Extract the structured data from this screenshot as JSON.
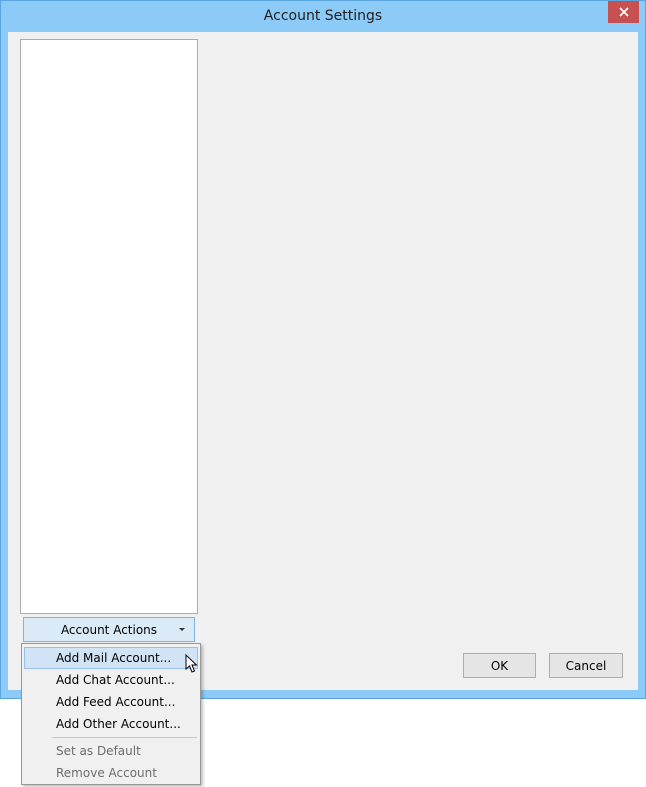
{
  "window": {
    "title": "Account Settings",
    "close_icon": "close-icon"
  },
  "sidebar": {
    "account_actions_label": "Account Actions",
    "dropdown_icon": "chevron-down-icon"
  },
  "buttons": {
    "ok": "OK",
    "cancel": "Cancel"
  },
  "menu": {
    "items": [
      {
        "label": "Add Mail Account...",
        "state": "hover"
      },
      {
        "label": "Add Chat Account...",
        "state": "enabled"
      },
      {
        "label": "Add Feed Account...",
        "state": "enabled"
      },
      {
        "label": "Add Other Account...",
        "state": "enabled"
      },
      {
        "label": "Set as Default",
        "state": "disabled"
      },
      {
        "label": "Remove Account",
        "state": "disabled"
      }
    ]
  },
  "colors": {
    "frame": "#8ccaf7",
    "close": "#c75050",
    "hover": "#d1e3f5",
    "client": "#f0f0f0"
  }
}
